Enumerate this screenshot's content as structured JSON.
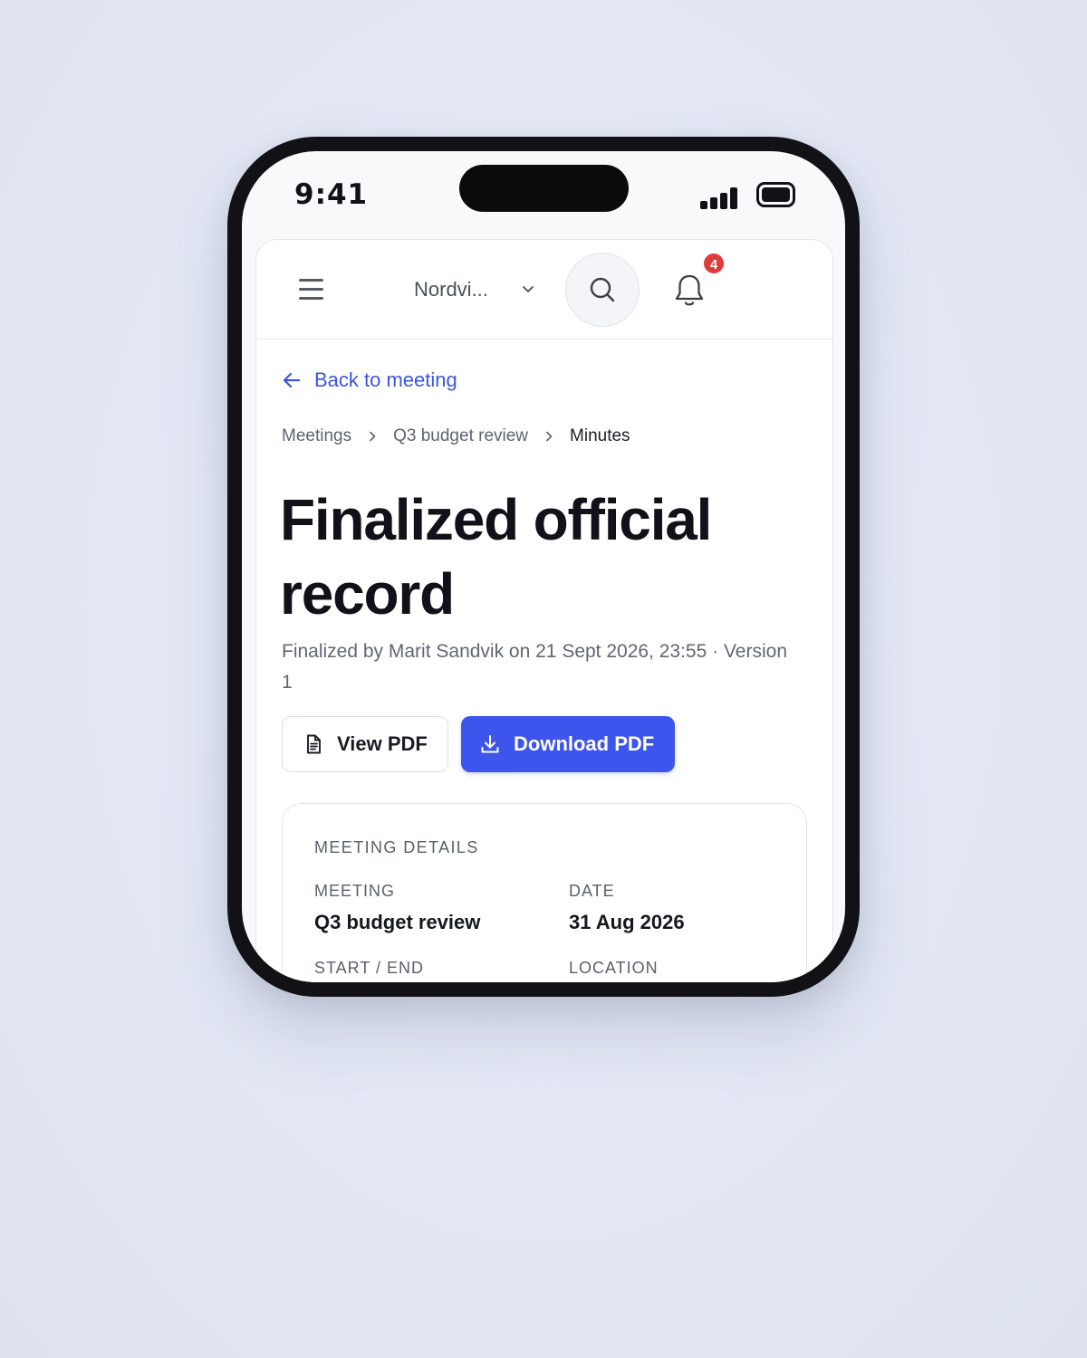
{
  "status_bar": {
    "time": "9:41"
  },
  "header": {
    "org_name": "Nordvi...",
    "notification_count": "4",
    "icons": [
      "menu-icon",
      "chevron-down-icon",
      "search-icon",
      "bell-icon"
    ]
  },
  "nav": {
    "back_label": "Back to meeting"
  },
  "breadcrumb": {
    "items": [
      "Meetings",
      "Q3 budget review",
      "Minutes"
    ]
  },
  "page": {
    "title": "Finalized official record",
    "meta": "Finalized by Marit Sandvik on 21 Sept 2026, 23:55 · Version 1"
  },
  "actions": {
    "view_pdf": "View PDF",
    "download_pdf": "Download PDF"
  },
  "details": {
    "heading": "MEETING DETAILS",
    "meeting_label": "MEETING",
    "meeting_value": "Q3 budget review",
    "date_label": "DATE",
    "date_value": "31 Aug 2026",
    "start_end_label": "START / END",
    "location_label": "LOCATION"
  },
  "colors": {
    "accent": "#3d55ec",
    "link": "#3b55e0",
    "badge": "#e03b3b",
    "title": "#111219"
  }
}
